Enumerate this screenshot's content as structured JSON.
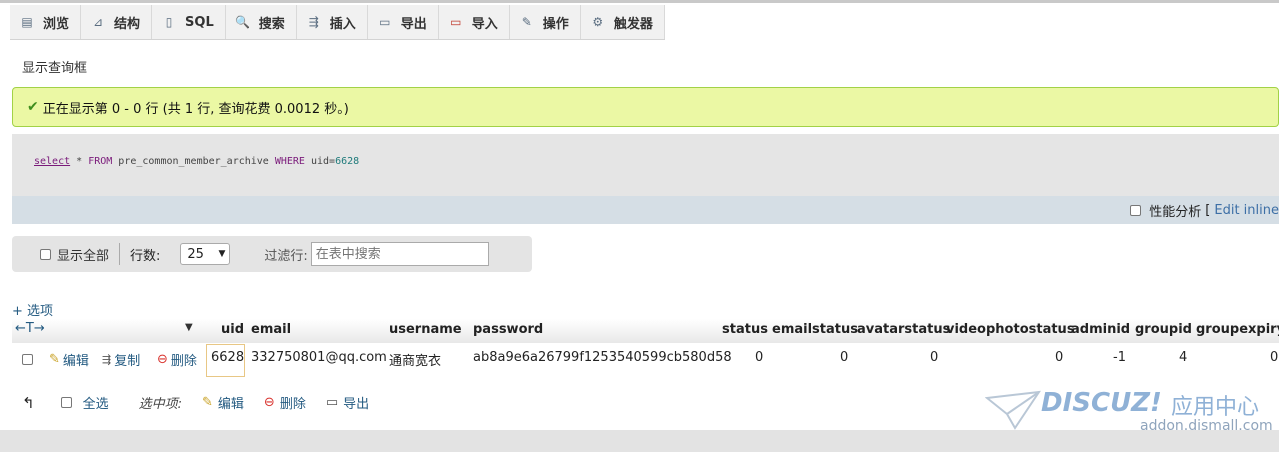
{
  "tabs": [
    {
      "label": "浏览",
      "icon": "browse-icon",
      "glyph": "▤"
    },
    {
      "label": "结构",
      "icon": "structure-icon",
      "glyph": "⊿"
    },
    {
      "label": "SQL",
      "icon": "sql-icon",
      "glyph": "▯"
    },
    {
      "label": "搜索",
      "icon": "search-icon",
      "glyph": "🔍"
    },
    {
      "label": "插入",
      "icon": "insert-icon",
      "glyph": "⇶"
    },
    {
      "label": "导出",
      "icon": "export-icon",
      "glyph": "▭"
    },
    {
      "label": "导入",
      "icon": "import-icon",
      "glyph": "▭"
    },
    {
      "label": "操作",
      "icon": "wrench-icon",
      "glyph": "✎"
    },
    {
      "label": "触发器",
      "icon": "trigger-icon",
      "glyph": "⚙"
    }
  ],
  "show_query_box": "显示查询框",
  "success_message": "正在显示第 0 - 0 行 (共 1 行, 查询花费 0.0012 秒。)",
  "sql": {
    "select": "select",
    "star": " * ",
    "from": "FROM",
    "table": " pre_common_member_archive ",
    "where": "WHERE",
    "cond": " uid=",
    "value": "6628"
  },
  "profiling": {
    "label": "性能分析",
    "bracket": "[",
    "edit_inline": "Edit inline"
  },
  "nav": {
    "show_all": "显示全部",
    "rows_label": "行数:",
    "rows_value": "25",
    "filter_label": "过滤行:",
    "filter_placeholder": "在表中搜索"
  },
  "options_link": "+ 选项",
  "columns": [
    "uid",
    "email",
    "username",
    "password",
    "status",
    "emailstatus",
    "avatarstatus",
    "videophotostatus",
    "adminid",
    "groupid",
    "groupexpiry"
  ],
  "nav_arrows": "←T→",
  "row": {
    "edit": "编辑",
    "copy": "复制",
    "delete": "删除",
    "uid": "6628",
    "email": "332750801@qq.com",
    "username": "通商宽衣",
    "password": "ab8a9e6a26799f1253540599cb580d58",
    "status": "0",
    "emailstatus": "0",
    "avatarstatus": "0",
    "videophotostatus": "0",
    "adminid": "-1",
    "groupid": "4",
    "groupexpiry": "0"
  },
  "bottom": {
    "select_all": "全选",
    "selected_label": "选中项:",
    "edit": "编辑",
    "delete": "删除",
    "export": "导出"
  },
  "watermark": {
    "logo": "DISCUZ!",
    "cn": "应用中心",
    "url": "addon.dismall.com"
  },
  "colors": {
    "success_bg": "#ebf8a4",
    "link": "#235a81",
    "delete_red": "#d9332e"
  }
}
